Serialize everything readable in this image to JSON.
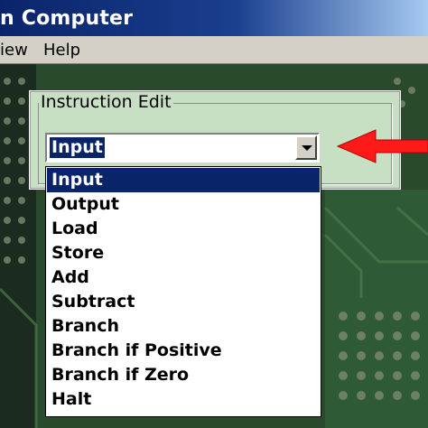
{
  "window": {
    "title": "n Computer"
  },
  "menu": {
    "items": [
      {
        "label": "iew"
      },
      {
        "label": "Help"
      }
    ]
  },
  "instruction_edit": {
    "group_label": "Instruction Edit",
    "combo_value": "Input",
    "options": [
      {
        "label": "Input",
        "selected": true
      },
      {
        "label": "Output",
        "selected": false
      },
      {
        "label": "Load",
        "selected": false
      },
      {
        "label": "Store",
        "selected": false
      },
      {
        "label": "Add",
        "selected": false
      },
      {
        "label": "Subtract",
        "selected": false
      },
      {
        "label": "Branch",
        "selected": false
      },
      {
        "label": "Branch if Positive",
        "selected": false
      },
      {
        "label": "Branch if Zero",
        "selected": false
      },
      {
        "label": "Halt",
        "selected": false
      }
    ]
  },
  "colors": {
    "titlebar": "#0a246a",
    "selection": "#0a246a",
    "group_background": "#c7dfc3",
    "arrow": "#ff1a1a",
    "board": "#2a4a2e"
  }
}
